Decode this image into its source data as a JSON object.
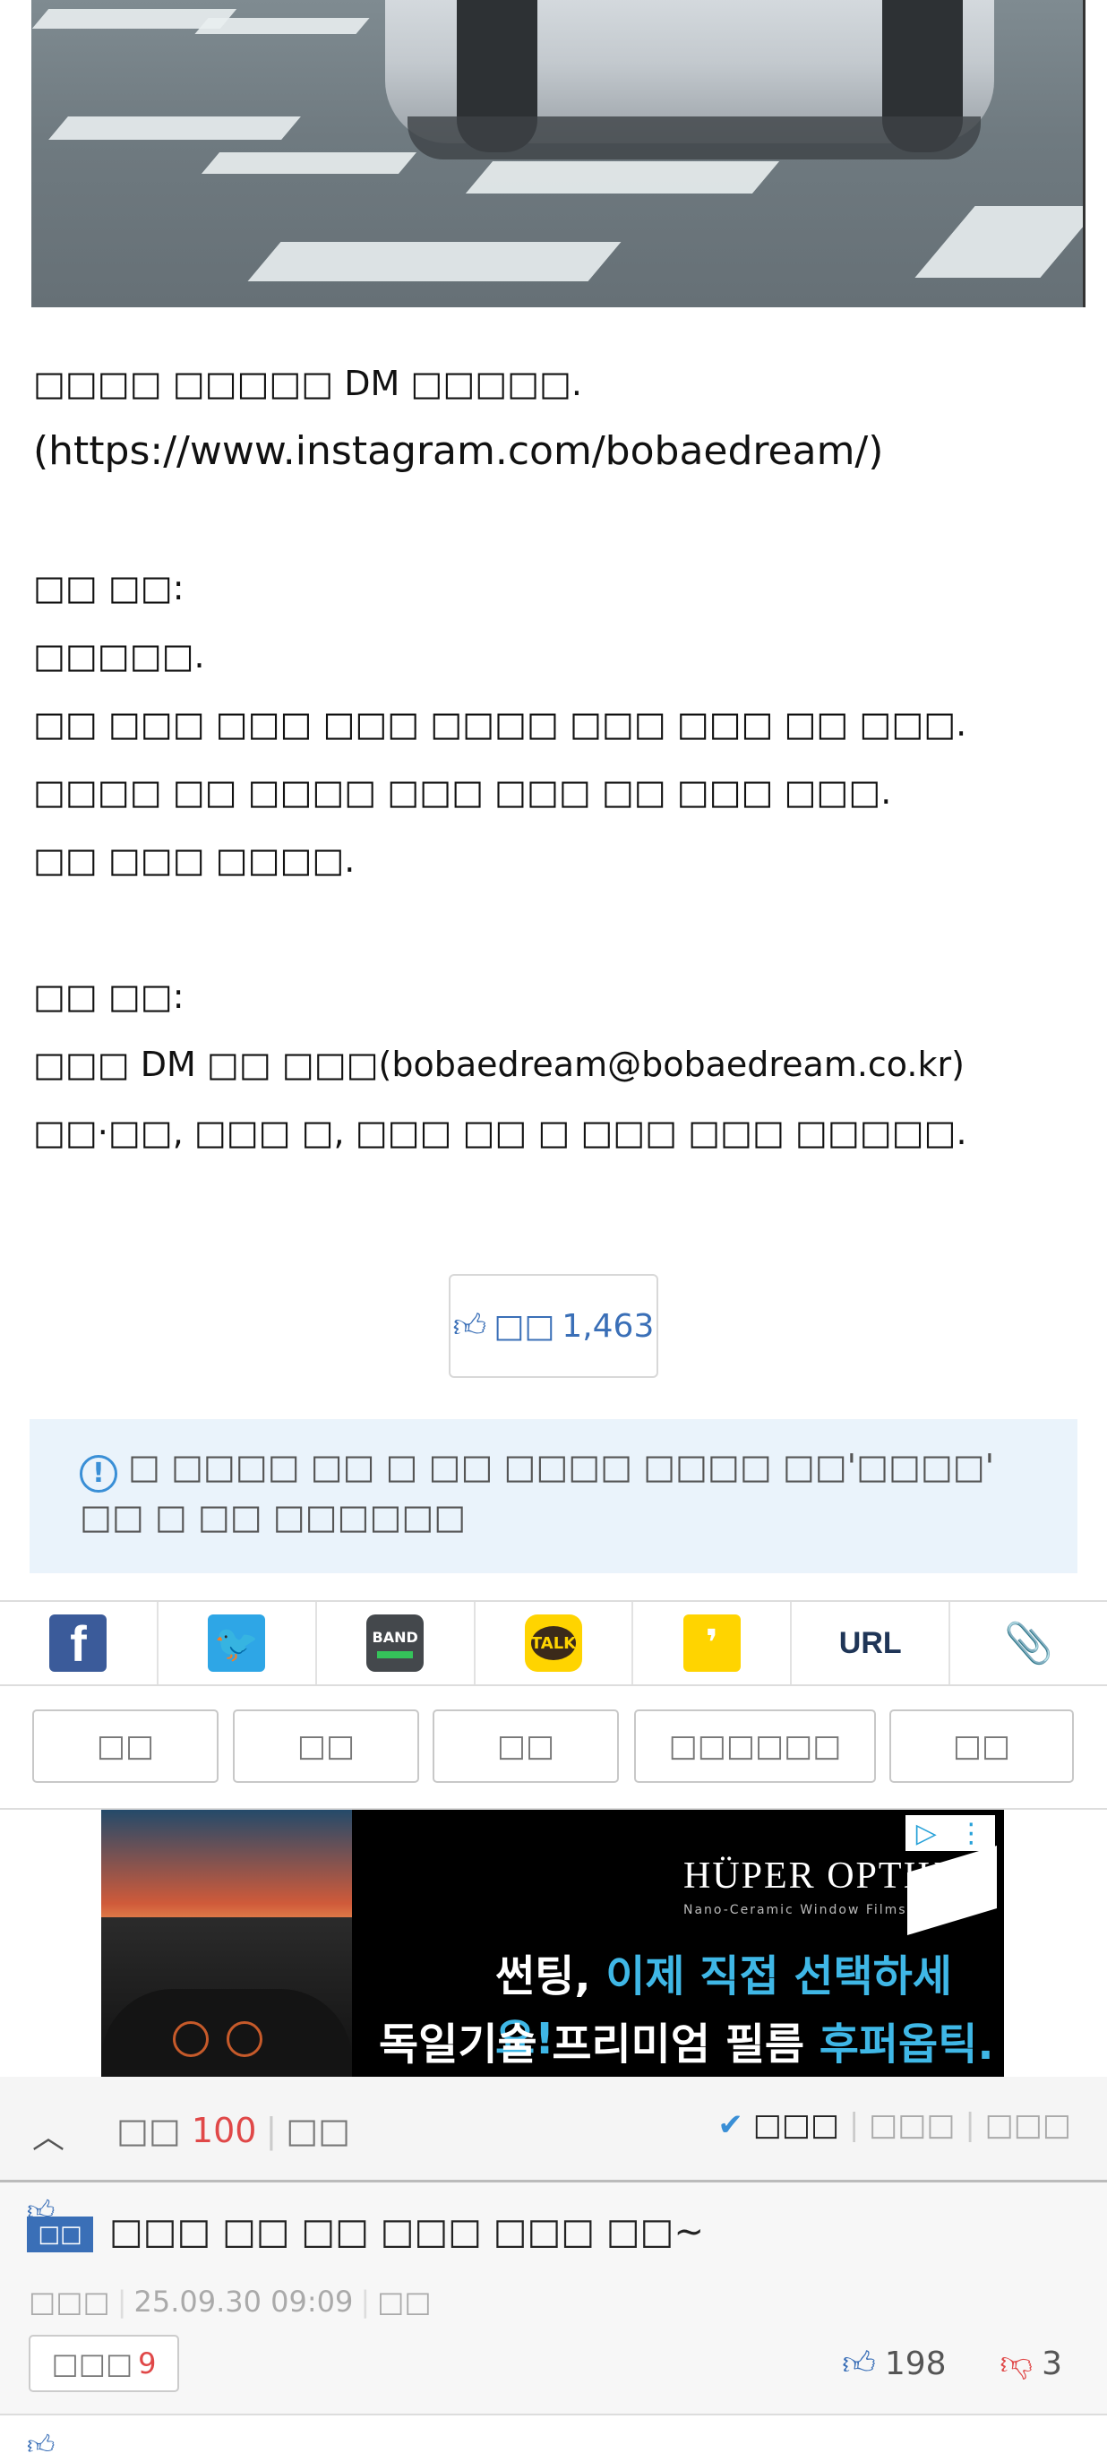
{
  "post": {
    "lines": [
      "□□□□ □□□□□ DM □□□□□.",
      "(https://www.instagram.com/bobaedream/)",
      "",
      "□□ □□:",
      "□□□□□.",
      "□□ □□□ □□□ □□□ □□□□ □□□ □□□ □□ □□□.",
      "□□□□ □□ □□□□ □□□ □□□ □□ □□□ □□□.",
      "□□ □□□ □□□□.",
      "",
      "□□ □□:",
      "□□□ DM □□ □□□(bobaedream@bobaedream.co.kr)",
      "□□·□□, □□□ □, □□□ □□ □ □□□ □□□ □□□□□."
    ]
  },
  "recommend": {
    "label": "□□",
    "count": "1,463"
  },
  "notice": {
    "text": "□ □□□□ □□ □ □□ □□□□ □□□□ □□'□□□□' □□ □ □□ □□□□□□"
  },
  "share": {
    "facebook": "f",
    "twitter": "🐦",
    "band": "BAND",
    "kakaotalk": "TALK",
    "kakaostory": "❜",
    "url": "URL",
    "clip": "📎"
  },
  "actions": [
    "□□",
    "□□",
    "□□",
    "□□□□□□",
    "□□"
  ],
  "ad": {
    "brand": "HÜPER OPTIK®",
    "sub": "Nano-Ceramic Window Films",
    "line1_a": "썬팅, ",
    "line1_b": "이제 직접 선택하세요!",
    "line2_a": "독일기술 프리미엄 필름 ",
    "line2_b": "후퍼옵틱."
  },
  "comments_header": {
    "label": "□□",
    "count": "100",
    "extra": "□□",
    "sort": [
      "□□□",
      "□□□",
      "□□□"
    ]
  },
  "comment": {
    "badge": "□□",
    "text": "□□□ □□ □□ □□□ □□□ □□~",
    "author": "□□□",
    "datetime": "25.09.30  09:09",
    "action": "□□",
    "reply_label": "□□□",
    "reply_count": "9",
    "likes": "198",
    "dislikes": "3"
  }
}
